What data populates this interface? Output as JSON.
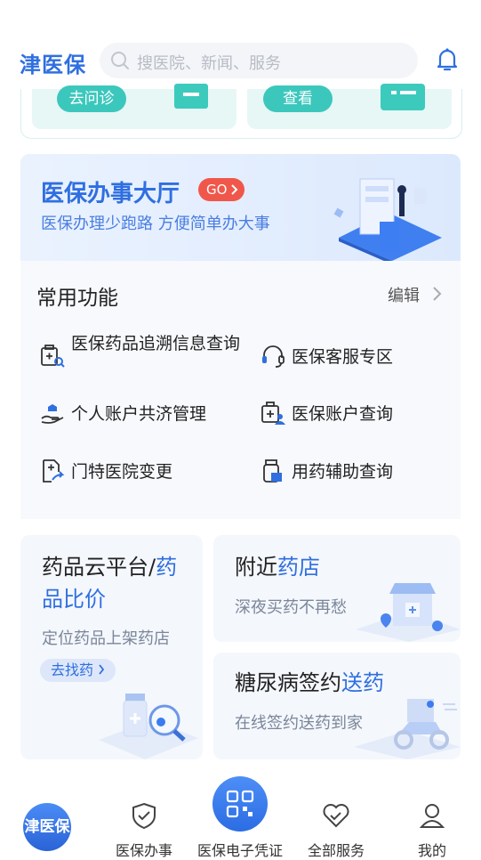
{
  "header": {
    "logo": "津医保",
    "search_placeholder": "搜医院、新闻、服务"
  },
  "top_card": {
    "left_button": "去问诊",
    "right_button": "查看"
  },
  "hall": {
    "title": "医保办事大厅",
    "go_badge": "GO",
    "subtitle": "医保办理少跑路 方便简单办大事"
  },
  "common_functions": {
    "title": "常用功能",
    "edit_label": "编辑",
    "items": [
      {
        "label": "医保药品追溯信息查询",
        "icon": "drug-search-icon"
      },
      {
        "label": "医保客服专区",
        "icon": "headset-icon"
      },
      {
        "label": "个人账户共济管理",
        "icon": "hand-care-icon"
      },
      {
        "label": "医保账户查询",
        "icon": "medkit-user-icon"
      },
      {
        "label": "门特医院变更",
        "icon": "document-change-icon"
      },
      {
        "label": "用药辅助查询",
        "icon": "medicine-bottle-icon"
      }
    ]
  },
  "cards": {
    "drug_cloud": {
      "title_a": "药品云平台/",
      "title_b": "药品比价",
      "subtitle": "定位药品上架药店",
      "button": "去找药"
    },
    "nearby": {
      "title_a": "附近",
      "title_b": "药店",
      "subtitle": "深夜买药不再愁"
    },
    "diabetes": {
      "title_a": "糖尿病签约",
      "title_b": "送药",
      "subtitle": "在线签约送药到家"
    }
  },
  "bottom_nav": {
    "home": "津医保",
    "items": [
      "医保办事",
      "医保电子凭证",
      "全部服务",
      "我的"
    ]
  },
  "colors": {
    "brand_blue": "#2f6fe0",
    "teal": "#3cc7bd",
    "go_red": "#f0574a"
  }
}
